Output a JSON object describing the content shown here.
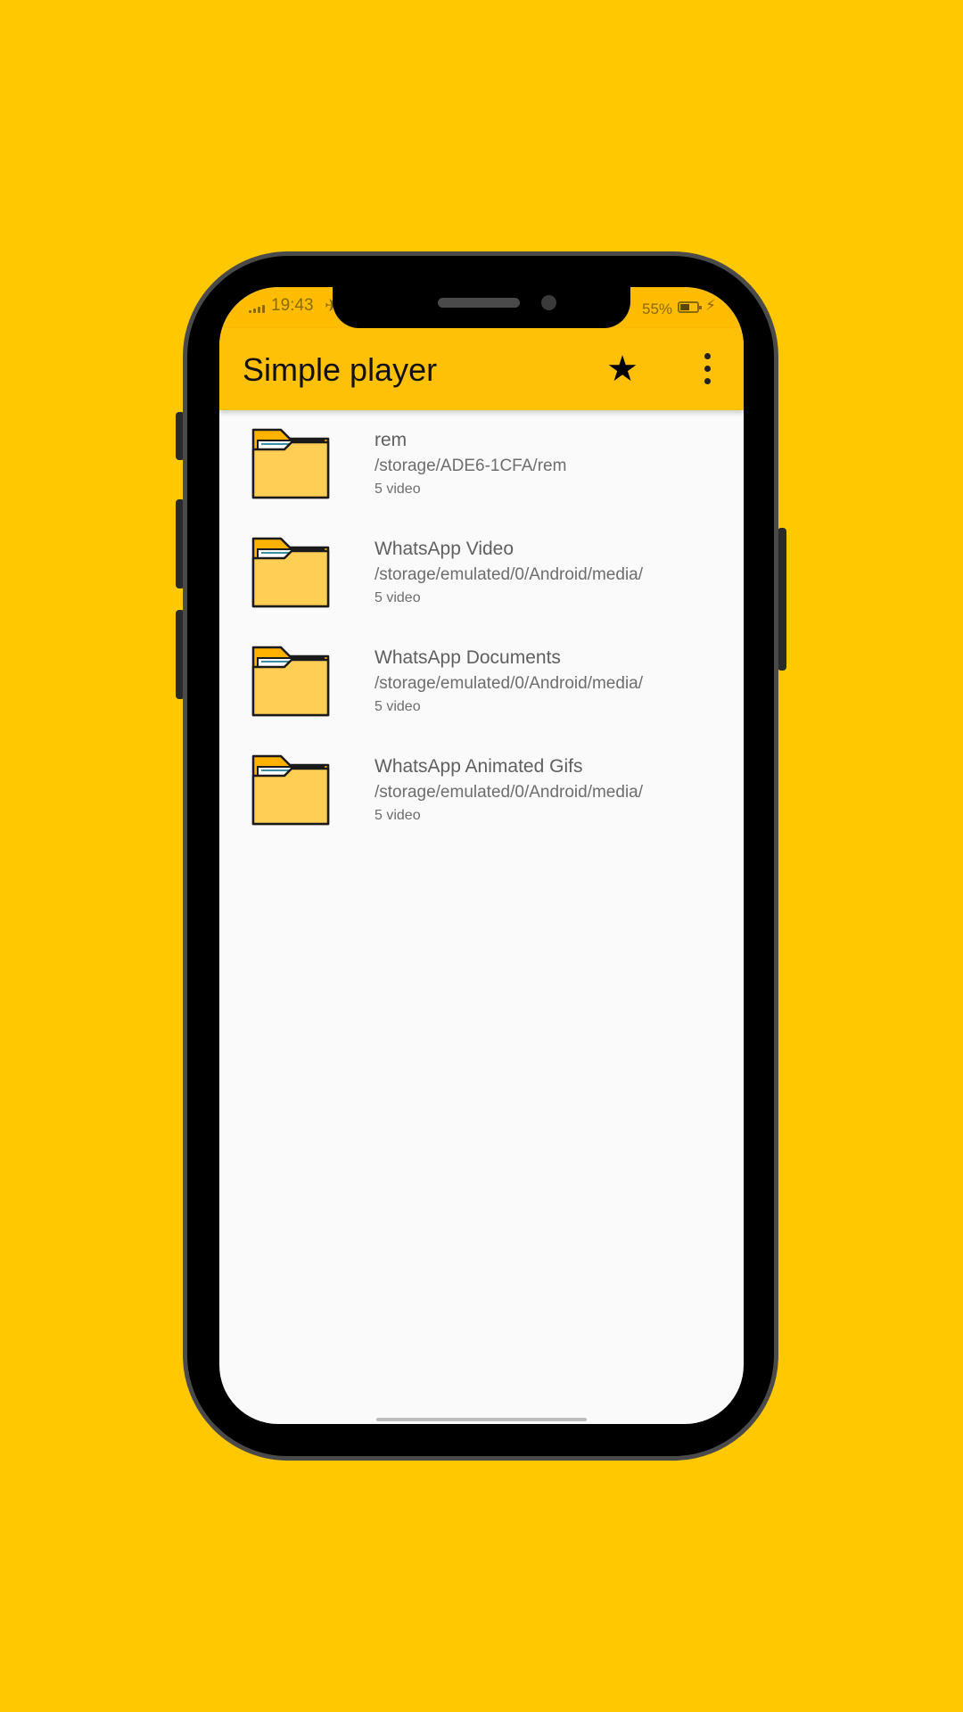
{
  "status_bar": {
    "time": "19:43",
    "extra_icon": "✈",
    "battery_percent": "55%",
    "charging_icon": "⚡"
  },
  "app_bar": {
    "title": "Simple player",
    "favorite_icon": "★",
    "menu_icon": "more-vert-icon",
    "background_color": "#FFC107"
  },
  "folders": [
    {
      "name": "rem",
      "path": "/storage/ADE6-1CFA/rem",
      "count": "5 video"
    },
    {
      "name": "WhatsApp Video",
      "path": "/storage/emulated/0/Android/media/",
      "count": "5 video"
    },
    {
      "name": "WhatsApp Documents",
      "path": "/storage/emulated/0/Android/media/",
      "count": "5 video"
    },
    {
      "name": "WhatsApp Animated Gifs",
      "path": "/storage/emulated/0/Android/media/",
      "count": "5 video"
    }
  ],
  "colors": {
    "page_background": "#FFC800",
    "status_bar": "#FFBC00",
    "folder_body": "#FFCE54",
    "folder_tab": "#FFB300"
  }
}
